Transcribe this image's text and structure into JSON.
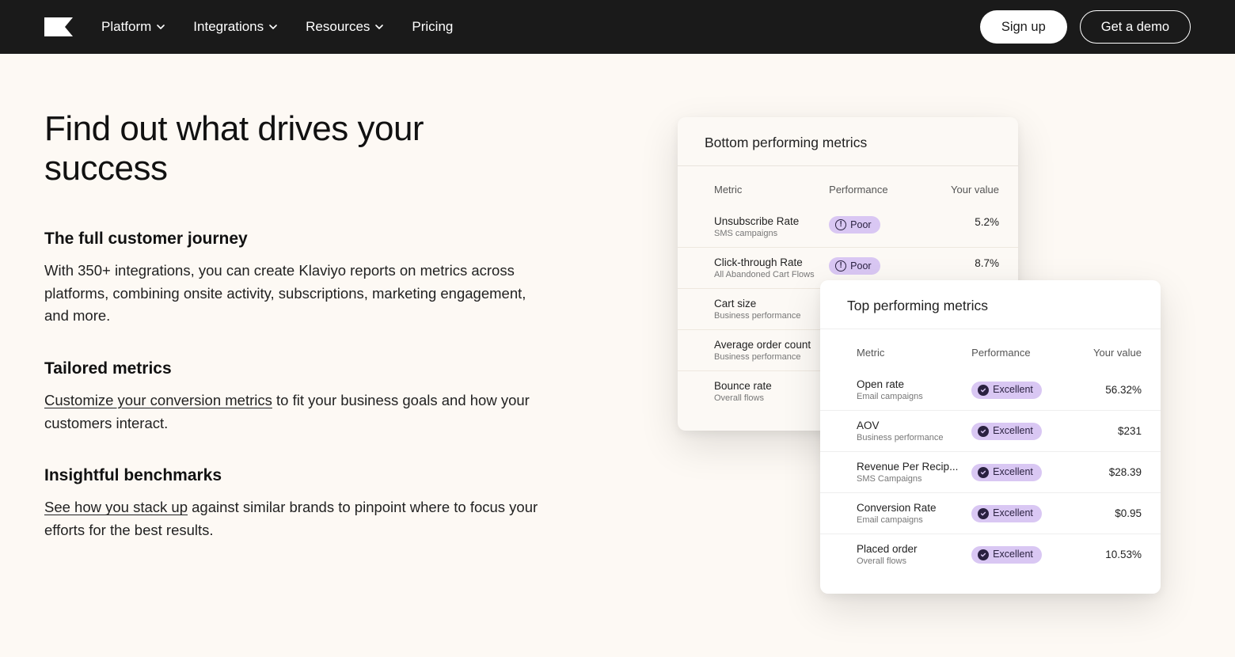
{
  "nav": {
    "items": [
      "Platform",
      "Integrations",
      "Resources",
      "Pricing"
    ],
    "signup": "Sign up",
    "demo": "Get a demo"
  },
  "hero": {
    "title": "Find out what drives your success"
  },
  "sections": [
    {
      "heading": "The full customer journey",
      "body_plain": "With 350+ integrations, you can create Klaviyo reports on metrics across platforms, combining onsite activity, subscriptions, marketing engagement, and more."
    },
    {
      "heading": "Tailored metrics",
      "link": "Customize your conversion metrics",
      "body_after_link": " to fit your business goals and how your customers interact."
    },
    {
      "heading": "Insightful benchmarks",
      "link": "See how you stack up",
      "body_after_link": " against similar brands to pinpoint where to focus your efforts for the best results."
    }
  ],
  "columns": {
    "metric": "Metric",
    "performance": "Performance",
    "value": "Your value"
  },
  "badges": {
    "poor": "Poor",
    "excellent": "Excellent"
  },
  "bottom_card": {
    "title": "Bottom performing metrics",
    "rows": [
      {
        "name": "Unsubscribe Rate",
        "sub": "SMS campaigns",
        "perf": "poor",
        "value": "5.2%"
      },
      {
        "name": "Click-through Rate",
        "sub": "All Abandoned Cart Flows",
        "perf": "poor",
        "value": "8.7%"
      },
      {
        "name": "Cart size",
        "sub": "Business performance",
        "perf": "",
        "value": ""
      },
      {
        "name": "Average order count",
        "sub": "Business performance",
        "perf": "",
        "value": ""
      },
      {
        "name": "Bounce rate",
        "sub": "Overall flows",
        "perf": "",
        "value": ""
      }
    ]
  },
  "top_card": {
    "title": "Top performing metrics",
    "rows": [
      {
        "name": "Open rate",
        "sub": "Email campaigns",
        "perf": "excellent",
        "value": "56.32%"
      },
      {
        "name": "AOV",
        "sub": "Business performance",
        "perf": "excellent",
        "value": "$231"
      },
      {
        "name": "Revenue Per Recip...",
        "sub": "SMS Campaigns",
        "perf": "excellent",
        "value": "$28.39"
      },
      {
        "name": "Conversion Rate",
        "sub": "Email campaigns",
        "perf": "excellent",
        "value": "$0.95"
      },
      {
        "name": "Placed order",
        "sub": "Overall flows",
        "perf": "excellent",
        "value": "10.53%"
      }
    ]
  }
}
